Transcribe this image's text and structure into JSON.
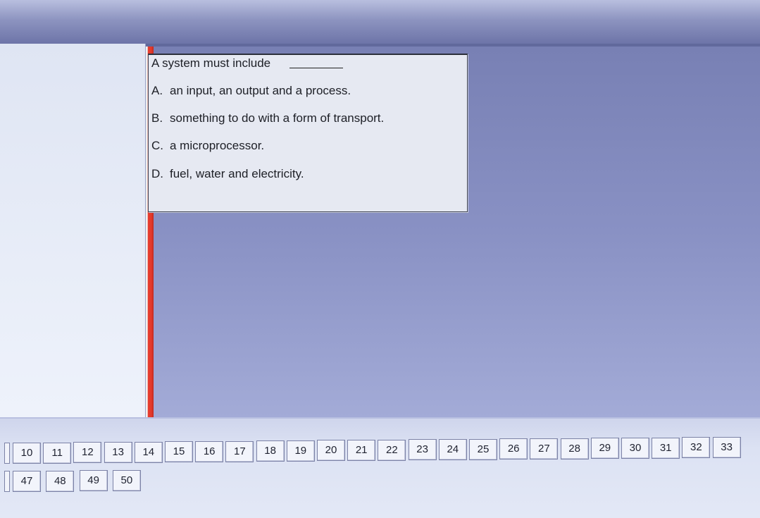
{
  "question": {
    "text": "A system must include",
    "options": [
      {
        "letter": "A.",
        "text": "an input, an output and a process."
      },
      {
        "letter": "B.",
        "text": "something to do with a form of transport."
      },
      {
        "letter": "C.",
        "text": "a microprocessor."
      },
      {
        "letter": "D.",
        "text": "fuel, water and electricity."
      }
    ]
  },
  "question_numbers_row1": [
    "10",
    "11",
    "12",
    "13",
    "14",
    "15",
    "16",
    "17",
    "18",
    "19",
    "20",
    "21",
    "22",
    "23",
    "24",
    "25",
    "26",
    "27",
    "28",
    "29",
    "30",
    "31",
    "32",
    "33"
  ],
  "question_numbers_row2": [
    "47",
    "48",
    "49",
    "50"
  ]
}
